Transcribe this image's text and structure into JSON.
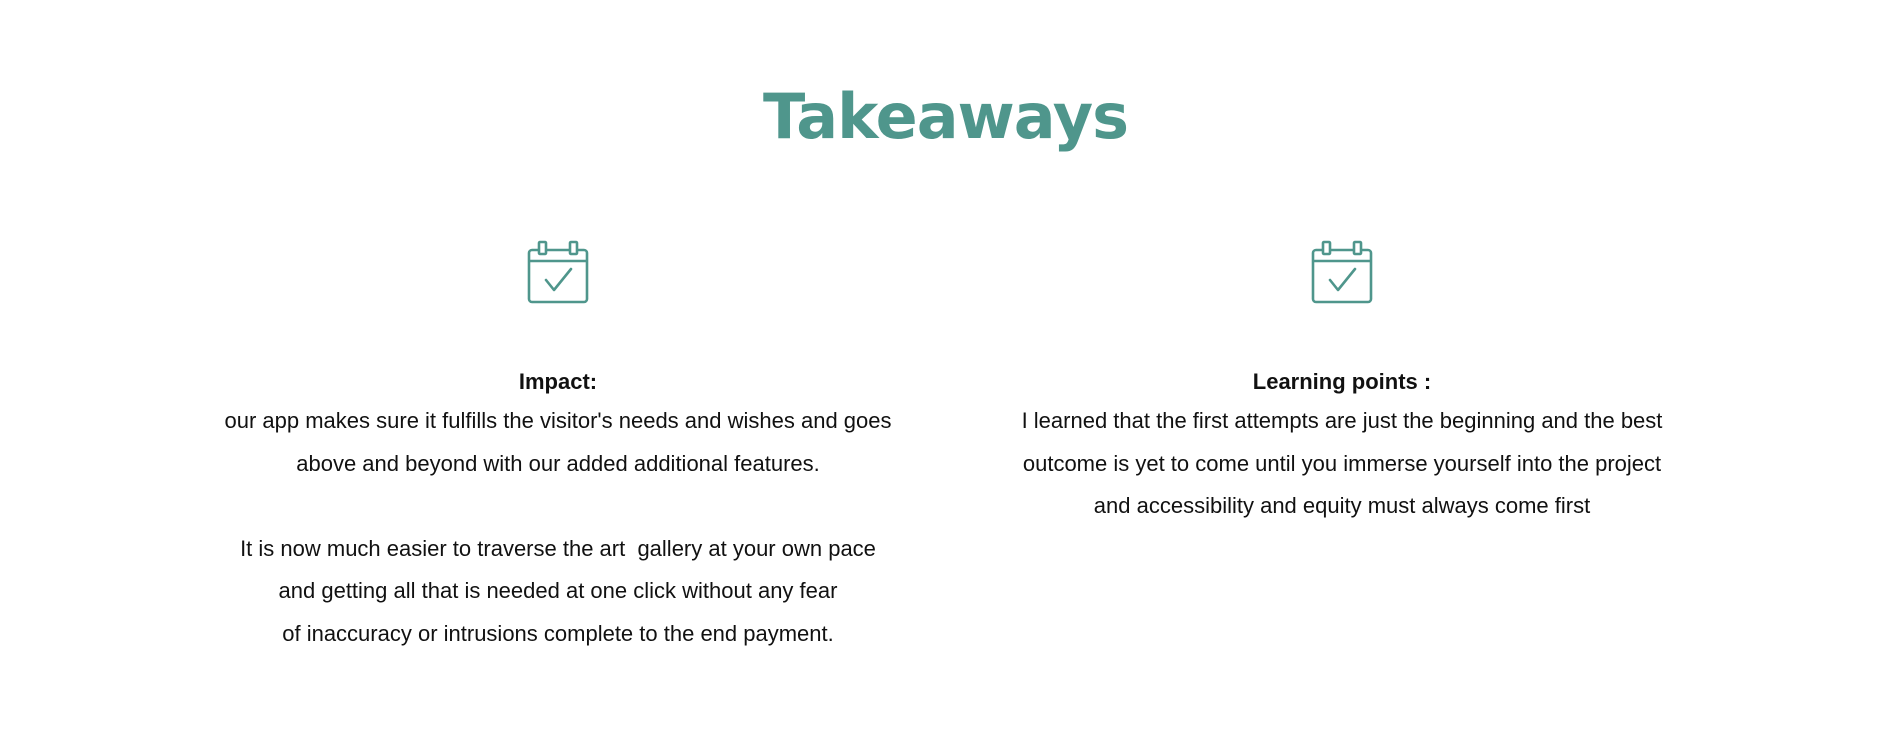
{
  "page": {
    "title": "Takeaways",
    "accent_color": "#4f968c"
  },
  "sections": [
    {
      "icon": "calendar-check-icon",
      "heading": "Impact:",
      "paragraphs": [
        [
          "our app makes sure it fulfills the visitor's needs and wishes and goes",
          "above and beyond with our added additional features."
        ],
        [
          "It is now much easier to traverse the art  gallery at your own pace",
          "and getting all that is needed at one click without any fear",
          "of inaccuracy or intrusions complete to the end payment."
        ]
      ]
    },
    {
      "icon": "calendar-check-icon",
      "heading": "Learning points :",
      "paragraphs": [
        [
          "I learned that the first attempts are just the beginning and the best",
          "outcome is yet to come until you immerse yourself into the project",
          "and accessibility and equity must always come first"
        ]
      ]
    }
  ]
}
